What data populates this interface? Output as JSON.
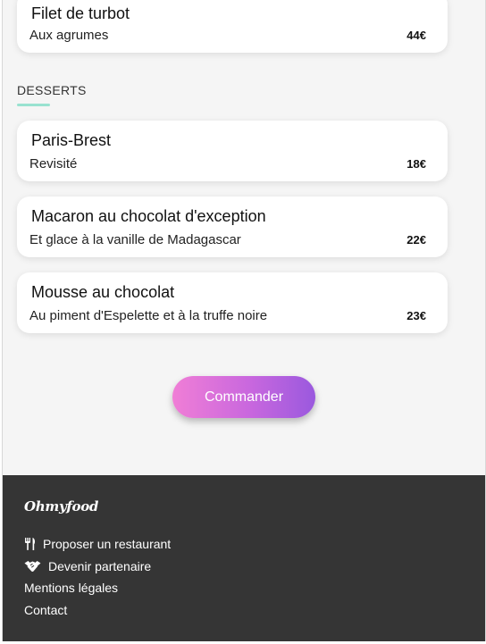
{
  "menu": {
    "top_item": {
      "name": "Filet de turbot",
      "description": "Aux agrumes",
      "price": "44€"
    },
    "desserts": {
      "title": "DESSERTS",
      "items": [
        {
          "name": "Paris-Brest",
          "description": "Revisité",
          "price": "18€"
        },
        {
          "name": "Macaron au chocolat d'exception",
          "description": "Et glace à la vanille de Madagascar",
          "price": "22€"
        },
        {
          "name": "Mousse au chocolat",
          "description": "Au piment d'Espelette et à la truffe noire",
          "price": "23€"
        }
      ]
    }
  },
  "order_button": {
    "label": "Commander"
  },
  "footer": {
    "brand": "Ohmyfood",
    "links": [
      {
        "label": "Proposer un restaurant",
        "icon": "utensils-icon"
      },
      {
        "label": "Devenir partenaire",
        "icon": "handshake-icon"
      },
      {
        "label": "Mentions légales"
      },
      {
        "label": "Contact"
      }
    ]
  },
  "colors": {
    "page_background": "#f5f5f5",
    "card_background": "#ffffff",
    "section_underline": "#99e2d0",
    "button_gradient_start": "#f07ed6",
    "button_gradient_end": "#9a59de",
    "footer_background": "#353535"
  }
}
